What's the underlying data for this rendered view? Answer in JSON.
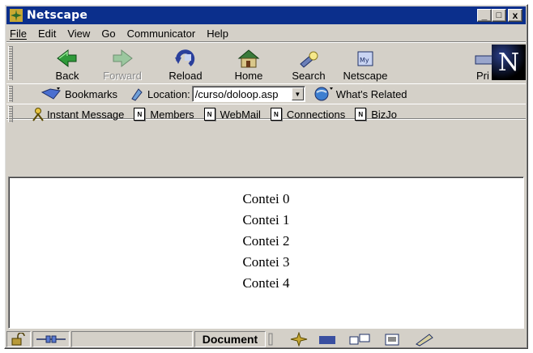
{
  "window": {
    "title": "Netscape"
  },
  "title_buttons": [
    "_",
    "□",
    "x"
  ],
  "menu": [
    {
      "label": "File"
    },
    {
      "label": "Edit"
    },
    {
      "label": "View"
    },
    {
      "label": "Go"
    },
    {
      "label": "Communicator"
    },
    {
      "label": "Help"
    }
  ],
  "nav": {
    "back": "Back",
    "forward": "Forward",
    "reload": "Reload",
    "home": "Home",
    "search": "Search",
    "netscape": "Netscape",
    "print": "Pri",
    "logo": "N"
  },
  "location_bar": {
    "bookmarks": "Bookmarks",
    "location_label": "Location:",
    "url": "/curso/doloop.asp",
    "whats_related": "What's Related"
  },
  "personal_toolbar": [
    {
      "label": "Instant Message"
    },
    {
      "label": "Members"
    },
    {
      "label": "WebMail"
    },
    {
      "label": "Connections"
    },
    {
      "label": "BizJo"
    }
  ],
  "content": {
    "lines": [
      "Contei 0",
      "Contei 1",
      "Contei 2",
      "Contei 3",
      "Contei 4"
    ]
  },
  "status": {
    "document": "Document"
  },
  "colors": {
    "titlebar": "#0b2f8c",
    "chrome": "#d4d0c8",
    "content_bg": "#ffffff"
  }
}
